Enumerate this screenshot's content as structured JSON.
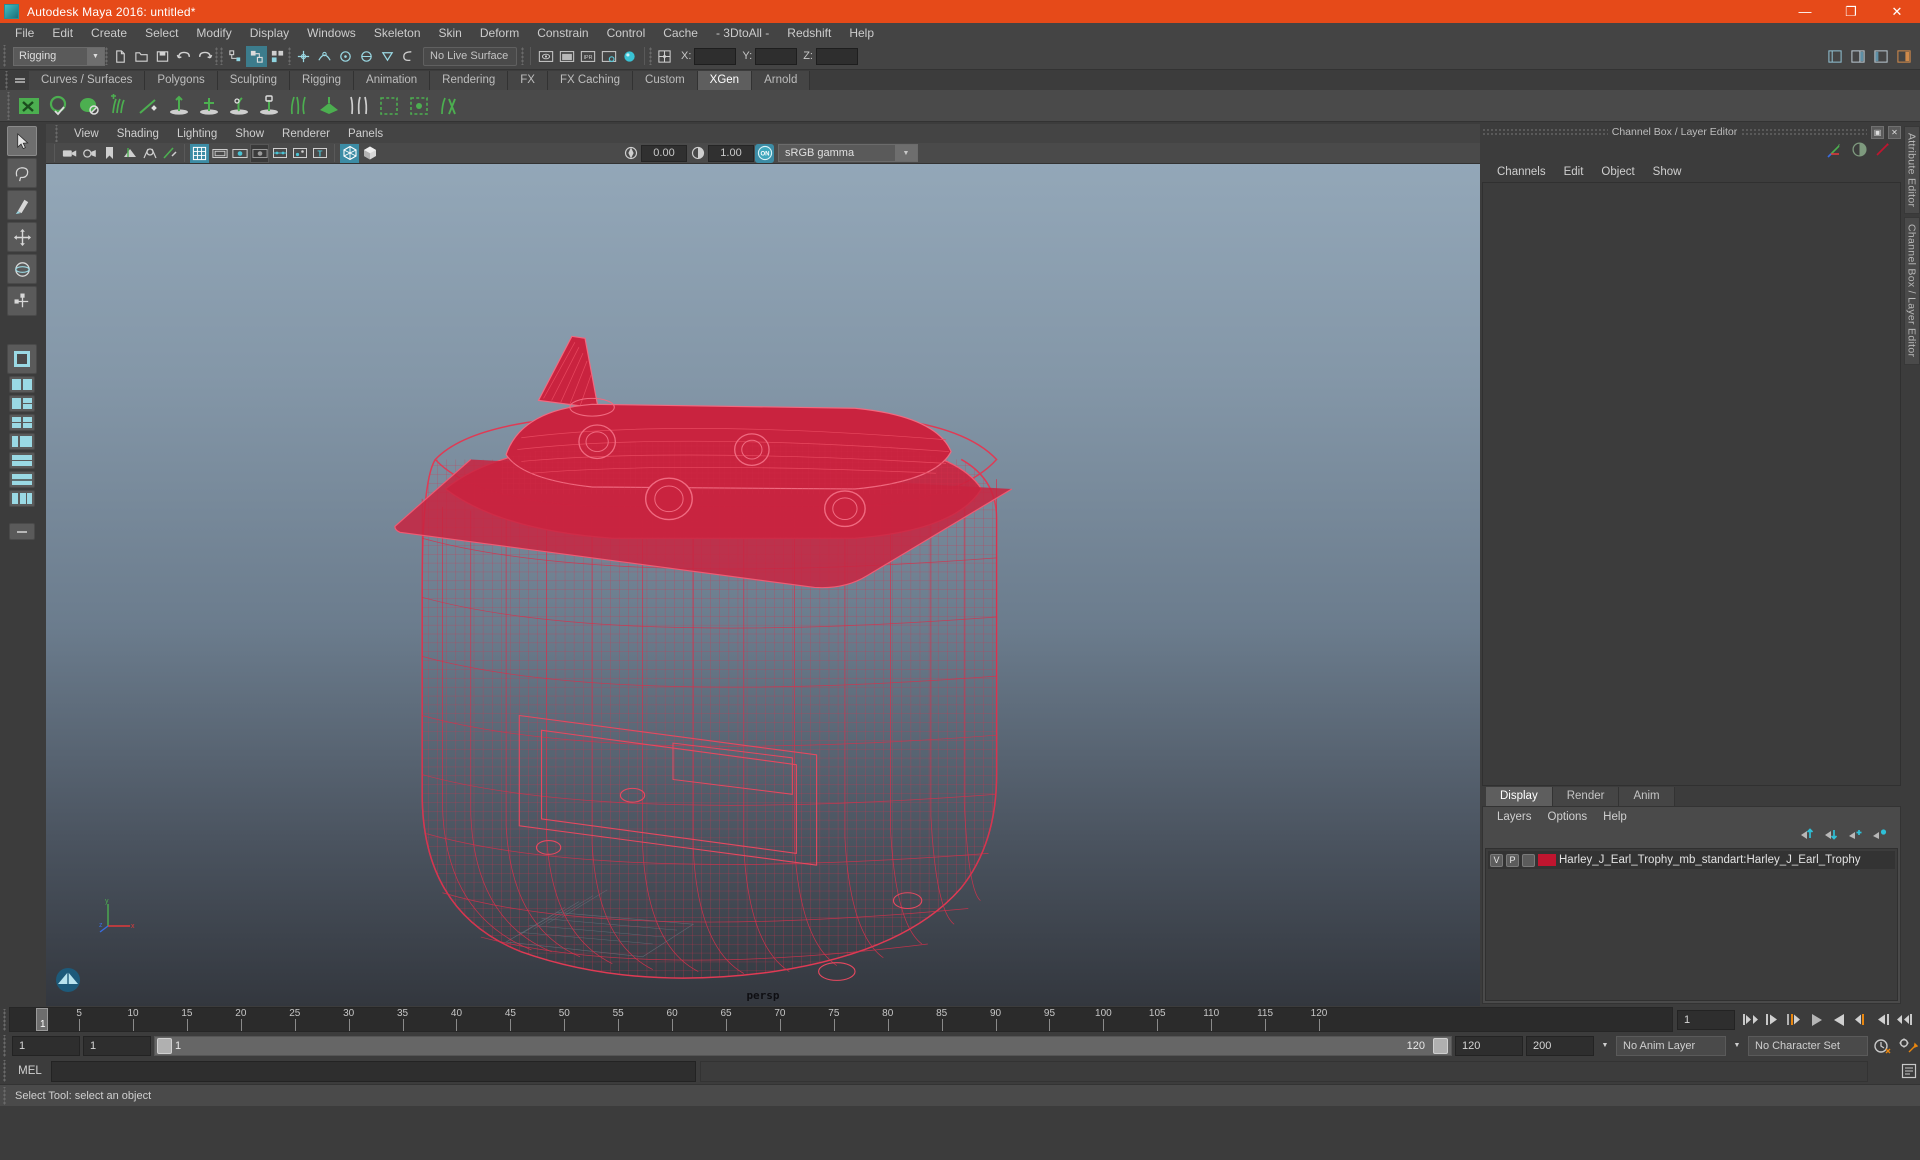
{
  "window": {
    "title": "Autodesk Maya 2016: untitled*",
    "minimize": "—",
    "maximize": "❐",
    "close": "✕"
  },
  "menubar": {
    "items": [
      "File",
      "Edit",
      "Create",
      "Select",
      "Modify",
      "Display",
      "Windows",
      "Skeleton",
      "Skin",
      "Deform",
      "Constrain",
      "Control",
      "Cache",
      "- 3DtoAll -",
      "Redshift",
      "Help"
    ]
  },
  "statusline": {
    "menu_set": "Rigging",
    "live_surface": "No Live Surface",
    "coord_x_label": "X:",
    "coord_y_label": "Y:",
    "coord_z_label": "Z:",
    "coord_x_value": "",
    "coord_y_value": "",
    "coord_z_value": ""
  },
  "shelf": {
    "tabs": [
      "Curves / Surfaces",
      "Polygons",
      "Sculpting",
      "Rigging",
      "Animation",
      "Rendering",
      "FX",
      "FX Caching",
      "Custom",
      "XGen",
      "Arnold"
    ],
    "active_tab": "XGen",
    "icons": [
      "xgen-description-icon",
      "xgen-spline-icon",
      "xgen-sphere-icon",
      "xgen-add-clump-icon",
      "xgen-anim-wire-icon",
      "xgen-cut-icon",
      "xgen-clump-icon",
      "xgen-coil-icon",
      "xgen-noise-icon",
      "xgen-region-icon",
      "xgen-preview-icon",
      "xgen-guide-icon",
      "xgen-density-icon",
      "xgen-mask-icon",
      "xgen-export-icon"
    ]
  },
  "toolbox": {
    "items": [
      {
        "name": "select-tool",
        "selected": true
      },
      {
        "name": "lasso-select-tool",
        "selected": false
      },
      {
        "name": "paint-select-tool",
        "selected": false
      },
      {
        "name": "move-tool",
        "selected": false
      },
      {
        "name": "rotate-tool",
        "selected": false
      },
      {
        "name": "scale-tool",
        "selected": false
      }
    ],
    "layouts": [
      "single-perspective-layout",
      "four-view-layout",
      "two-pane-side-layout",
      "two-pane-stacked-layout",
      "three-pane-layout",
      "outliner-persp-layout",
      "hypergraph-layout",
      "persp-graph-layout"
    ]
  },
  "viewport": {
    "panel_menus": [
      "View",
      "Shading",
      "Lighting",
      "Show",
      "Renderer",
      "Panels"
    ],
    "camera_label": "persp",
    "exposure_value": "0.00",
    "gamma_value": "1.00",
    "color_management": "sRGB gamma",
    "gamma_toggle": "ON",
    "toolbar_icons": [
      "select-camera-icon",
      "camera-attributes-icon",
      "bookmark-icon",
      "image-plane-icon",
      "two-sided-lighting-icon",
      "shadows-icon",
      "grid-icon",
      "film-gate-icon",
      "resolution-gate-icon",
      "gate-mask-icon",
      "wireframe-on-shaded-icon",
      "xray-icon",
      "xray-joints-icon",
      "textured-icon",
      "smooth-shade-icon"
    ],
    "model_color": "#d6314c",
    "model_name": "Harley_J_Earl_Trophy"
  },
  "channel_box": {
    "panel_title": "Channel Box / Layer Editor",
    "menus": [
      "Channels",
      "Edit",
      "Object",
      "Show"
    ],
    "tool_icons": [
      "channel-box-icon",
      "attribute-editor-icon",
      "modeling-toolkit-icon"
    ],
    "window_buttons": [
      "undock-icon",
      "close-icon"
    ]
  },
  "layer_editor": {
    "tabs": [
      "Display",
      "Render",
      "Anim"
    ],
    "active_tab": "Display",
    "menus": [
      "Layers",
      "Options",
      "Help"
    ],
    "buttons": [
      "move-layer-up-icon",
      "move-layer-down-icon",
      "new-layer-icon",
      "new-layer-from-selected-icon"
    ],
    "layers": [
      {
        "visibility": "V",
        "playback": "P",
        "template": "",
        "color": "#c0152f",
        "name": "Harley_J_Earl_Trophy_mb_standart:Harley_J_Earl_Trophy"
      }
    ]
  },
  "right_strip": {
    "labels": [
      "Attribute Editor",
      "Channel Box / Layer Editor"
    ]
  },
  "timeline": {
    "ticks": [
      5,
      10,
      15,
      20,
      25,
      30,
      35,
      40,
      45,
      50,
      55,
      60,
      65,
      70,
      75,
      80,
      85,
      90,
      95,
      100,
      105,
      110,
      115,
      120
    ],
    "start": 1,
    "end": 120,
    "current_frame": "1",
    "playhead_label": "1",
    "playback_buttons": [
      "go-to-start-icon",
      "step-back-keyframe-icon",
      "step-back-frame-icon",
      "play-backwards-icon",
      "play-forwards-icon",
      "step-forward-frame-icon",
      "step-forward-keyframe-icon",
      "go-to-end-icon"
    ]
  },
  "range_slider": {
    "anim_start": "1",
    "range_start": "1",
    "slider_label": "1",
    "slider_end_label": "120",
    "range_end": "120",
    "anim_end": "200",
    "anim_layer": "No Anim Layer",
    "character_set": "No Character Set",
    "auto_key_icon": "auto-keyframe-icon",
    "prefs_icon": "animation-preferences-icon"
  },
  "command_line": {
    "label": "MEL",
    "input_value": "",
    "output_value": ""
  },
  "help_line": {
    "text": "Select Tool: select an object"
  }
}
